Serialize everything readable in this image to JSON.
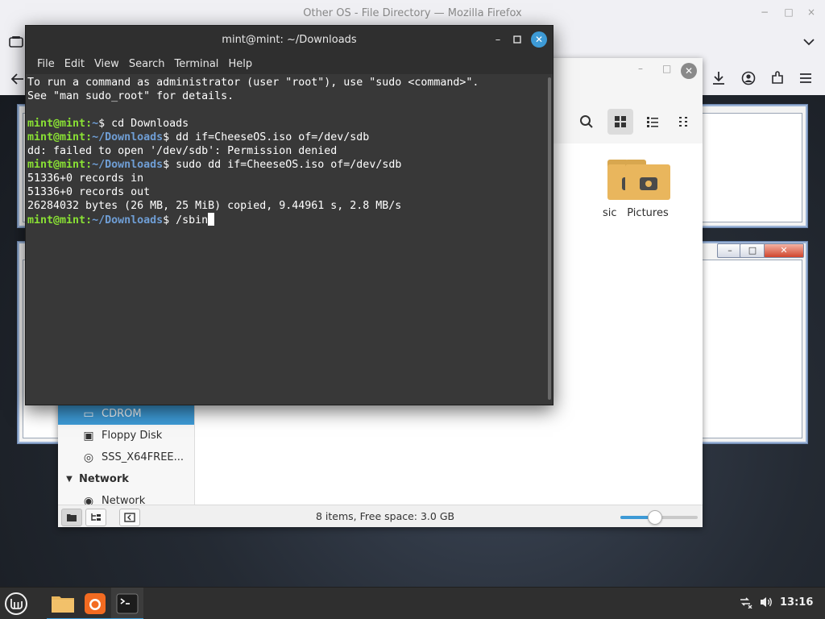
{
  "firefox": {
    "window_title": "Other OS - File Directory — Mozilla Firefox",
    "controls": {
      "minimize": "−",
      "maximize": "□",
      "close": "×"
    },
    "icons": [
      "tab-list-icon",
      "chevron-down-icon",
      "back-icon",
      "download-icon",
      "account-icon",
      "extensions-icon",
      "menu-icon"
    ]
  },
  "file_manager": {
    "view_buttons": [
      "search-icon",
      "icon-view-icon",
      "list-view-icon",
      "compact-view-icon"
    ],
    "folders": [
      {
        "label": "sic"
      },
      {
        "label": "Pictures"
      }
    ],
    "sidebar": {
      "items": [
        {
          "label": "CDROM",
          "icon": "cdrom-icon",
          "selected": true
        },
        {
          "label": "Floppy Disk",
          "icon": "floppy-icon",
          "selected": false
        },
        {
          "label": "SSS_X64FREE...",
          "icon": "disc-icon",
          "selected": false
        }
      ],
      "network_header": "Network",
      "network_item": "Network"
    },
    "status_text": "8 items, Free space: 3.0 GB",
    "zoom_fraction": 0.45
  },
  "terminal": {
    "title": "mint@mint: ~/Downloads",
    "menu": [
      "File",
      "Edit",
      "View",
      "Search",
      "Terminal",
      "Help"
    ],
    "lines": [
      {
        "text": "To run a command as administrator (user \"root\"), use \"sudo <command>\"."
      },
      {
        "text": "See \"man sudo_root\" for details."
      },
      {
        "text": ""
      },
      {
        "user": "mint@mint",
        "path": "~",
        "cmd": "$ cd Downloads"
      },
      {
        "user": "mint@mint",
        "path": "~/Downloads",
        "cmd": "$ dd if=CheeseOS.iso of=/dev/sdb"
      },
      {
        "text": "dd: failed to open '/dev/sdb': Permission denied"
      },
      {
        "user": "mint@mint",
        "path": "~/Downloads",
        "cmd": "$ sudo dd if=CheeseOS.iso of=/dev/sdb"
      },
      {
        "text": "51336+0 records in"
      },
      {
        "text": "51336+0 records out"
      },
      {
        "text": "26284032 bytes (26 MB, 25 MiB) copied, 9.44961 s, 2.8 MB/s"
      },
      {
        "user": "mint@mint",
        "path": "~/Downloads",
        "cmd": "$ /sbin",
        "cursor": true
      }
    ]
  },
  "taskbar": {
    "clock": "13:16",
    "apps": [
      "menu-icon",
      "files-icon",
      "firefox-icon",
      "terminal-icon"
    ]
  },
  "colors": {
    "accent": "#3d9ad6",
    "prompt_user": "#8ae234",
    "prompt_path": "#6f9ed5",
    "terminal_bg": "#383838",
    "folder": "#e9b65d"
  }
}
